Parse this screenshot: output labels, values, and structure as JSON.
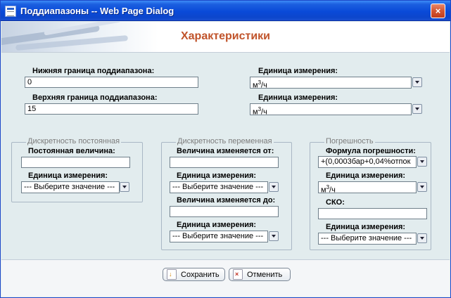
{
  "window": {
    "title": "Поддиапазоны -- Web Page Dialog",
    "close_glyph": "×"
  },
  "header": {
    "title": "Характеристики"
  },
  "range": {
    "lower_label": "Нижняя граница поддиапазона:",
    "lower_value": "0",
    "upper_label": "Верхняя граница поддиапазона:",
    "upper_value": "15",
    "unit_label_1": "Единица измерения:",
    "unit_label_2": "Единица измерения:",
    "unit_value_base": "м",
    "unit_value_exp": "3",
    "unit_value_tail": "/ч"
  },
  "const_group": {
    "legend": "Дискретность постоянная",
    "value_label": "Постоянная величина:",
    "value": "",
    "unit_label": "Единица измерения:",
    "unit_value": "--- Выберите значение ---"
  },
  "var_group": {
    "legend": "Дискретность переменная",
    "from_label": "Величина изменяется от:",
    "from_value": "",
    "unit_label_1": "Единица измерения:",
    "unit_value_1": "--- Выберите значение ---",
    "to_label": "Величина изменяется до:",
    "to_value": "",
    "unit_label_2": "Единица измерения:",
    "unit_value_2": "--- Выберите значение ---"
  },
  "error_group": {
    "legend": "Погрешность",
    "formula_label": "Формула погрешности:",
    "formula_value": "+(0,0003бар+0,04%отпок",
    "unit_label_1": "Единица измерения:",
    "sko_label": "СКО:",
    "sko_value": "",
    "unit_label_2": "Единица измерения:",
    "unit_value_2": "--- Выберите значение ---"
  },
  "footer": {
    "save_label": "Сохранить",
    "cancel_label": "Отменить"
  },
  "icons": {
    "window_icon": "dialog-window-icon",
    "dropdown_icon": "chevron-down-icon",
    "save_icon": "save-icon",
    "cancel_icon": "cancel-icon"
  },
  "colors": {
    "title_bar": "#0a4ad8",
    "heading": "#c0532a",
    "panel_bg": "#e2ecee",
    "legend_text": "#7c7c7c"
  }
}
